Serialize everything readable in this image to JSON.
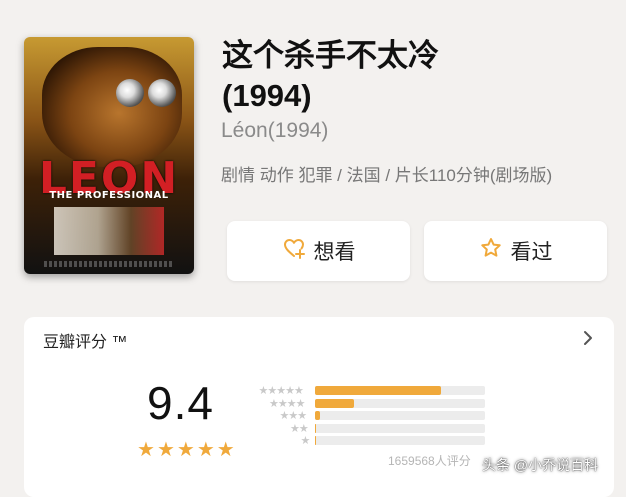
{
  "movie": {
    "title_line1": "这个杀手不太冷",
    "title_line2": "(1994)",
    "original_title": "Léon(1994)",
    "meta": "剧情 动作 犯罪 / 法国 / 片长110分钟(剧场版)"
  },
  "poster": {
    "title": "LEON",
    "subtitle": "THE PROFESSIONAL"
  },
  "actions": {
    "want_label": "想看",
    "want_icon": "heart-plus-icon",
    "seen_label": "看过",
    "seen_icon": "star-outline-icon"
  },
  "rating": {
    "header": "豆瓣评分 ™",
    "score": "9.4",
    "stars": 5,
    "distribution": [
      {
        "stars": 5,
        "fraction": 0.74
      },
      {
        "stars": 4,
        "fraction": 0.23
      },
      {
        "stars": 3,
        "fraction": 0.03
      },
      {
        "stars": 2,
        "fraction": 0.004
      },
      {
        "stars": 1,
        "fraction": 0.002
      }
    ],
    "count_text": "1659568人评分"
  },
  "watermark": "头条 @小乔说百科",
  "colors": {
    "accent": "#f0a93b",
    "background": "#f3f1ef",
    "card": "#ffffff"
  }
}
